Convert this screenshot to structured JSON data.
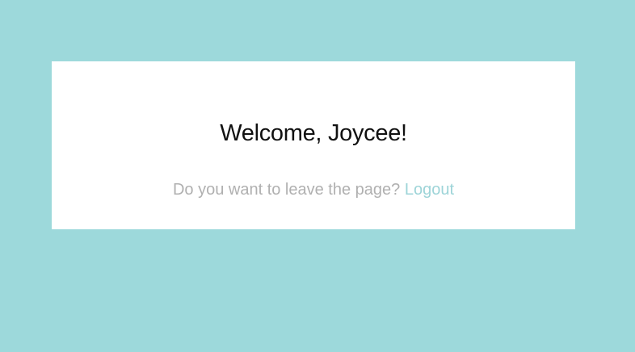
{
  "page": {
    "background_color": "#9dd9db"
  },
  "card": {
    "background_color": "#ffffff",
    "welcome_text": "Welcome, Joycee!",
    "welcome_color": "#111111",
    "leave_prompt": "Do you want to leave the page?",
    "leave_prompt_color": "#b0b0b0",
    "logout_label": "Logout",
    "logout_color": "#9dd4d8"
  }
}
